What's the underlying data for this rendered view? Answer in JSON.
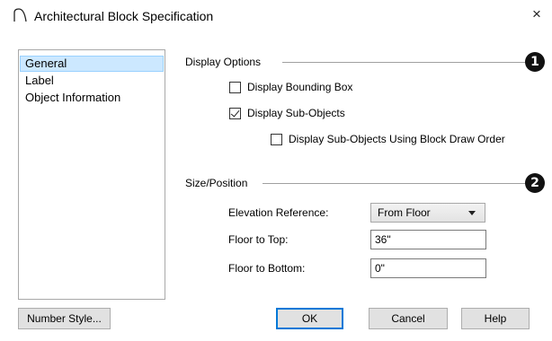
{
  "window": {
    "title": "Architectural Block Specification",
    "close_glyph": "×",
    "title_icon": "arc-icon"
  },
  "nav": {
    "items": [
      {
        "label": "General",
        "selected": true
      },
      {
        "label": "Label",
        "selected": false
      },
      {
        "label": "Object Information",
        "selected": false
      }
    ]
  },
  "display_options": {
    "heading": "Display Options",
    "badge": "1",
    "bounding_box": {
      "label": "Display Bounding Box",
      "checked": false
    },
    "sub_objects": {
      "label": "Display Sub-Objects",
      "checked": true
    },
    "draw_order": {
      "label": "Display Sub-Objects Using Block Draw Order",
      "checked": false
    }
  },
  "size_position": {
    "heading": "Size/Position",
    "badge": "2",
    "elevation_label": "Elevation Reference:",
    "elevation_value": "From Floor",
    "top_label": "Floor to Top:",
    "top_value": "36\"",
    "bottom_label": "Floor to Bottom:",
    "bottom_value": "0\""
  },
  "buttons": {
    "number_style": "Number Style...",
    "ok": "OK",
    "cancel": "Cancel",
    "help": "Help"
  }
}
